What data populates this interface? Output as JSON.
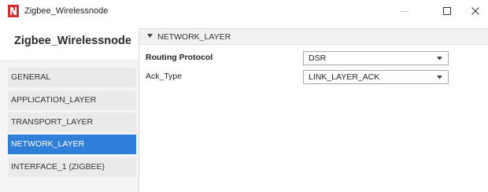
{
  "window": {
    "title": "Zigbee_Wirelessnode",
    "app_icon": "netsim-logo-icon",
    "controls": [
      "minimize-icon",
      "maximize-icon",
      "close-icon"
    ]
  },
  "sidebar": {
    "title": "Zigbee_Wirelessnode",
    "items": [
      {
        "label": "GENERAL",
        "active": false
      },
      {
        "label": "APPLICATION_LAYER",
        "active": false
      },
      {
        "label": "TRANSPORT_LAYER",
        "active": false
      },
      {
        "label": "NETWORK_LAYER",
        "active": true
      },
      {
        "label": "INTERFACE_1 (ZIGBEE)",
        "active": false
      }
    ]
  },
  "section": {
    "title": "NETWORK_LAYER",
    "expanded": true,
    "properties": [
      {
        "label": "Routing Protocol",
        "bold": true,
        "value": "DSR"
      },
      {
        "label": "Ack_Type",
        "bold": false,
        "value": "LINK_LAYER_ACK"
      }
    ]
  },
  "colors": {
    "accent": "#2f7fd8",
    "logo": "#d32f2f"
  }
}
